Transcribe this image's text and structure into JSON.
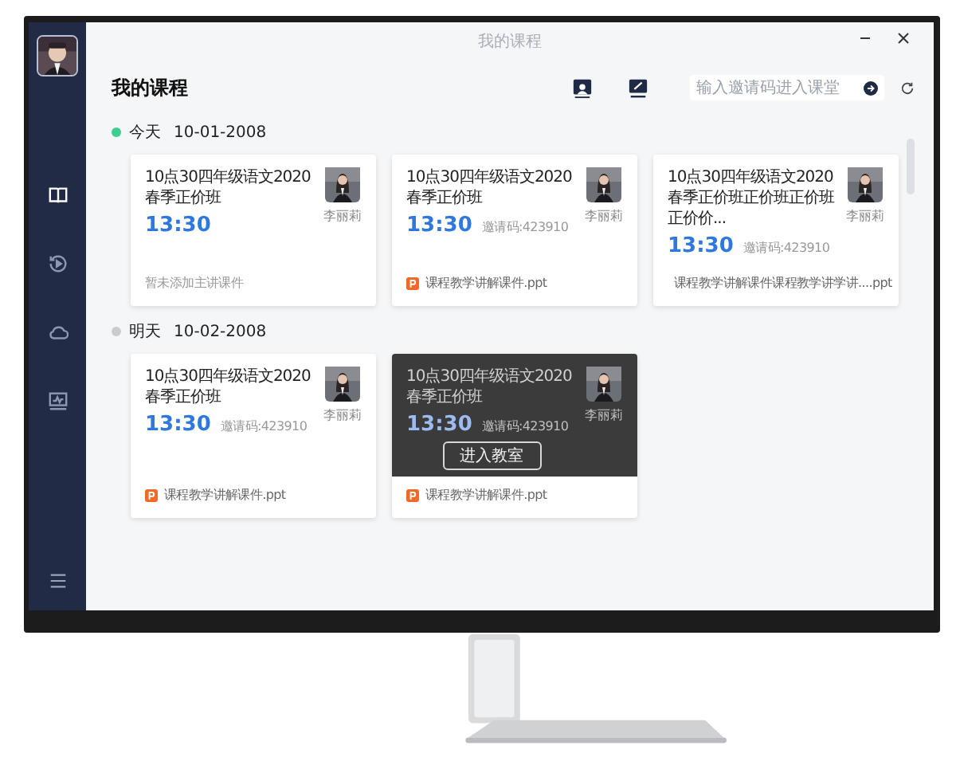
{
  "window": {
    "title": "我的课程"
  },
  "sidebar": {
    "items": [
      {
        "selected": true
      },
      {
        "selected": false
      },
      {
        "selected": false
      },
      {
        "selected": false
      }
    ]
  },
  "header": {
    "title": "我的课程",
    "invite": {
      "placeholder": "输入邀请码进入课堂"
    }
  },
  "sections": [
    {
      "day": "今天",
      "date": "10-01-2008",
      "active": true,
      "courses": [
        {
          "title": "10点30四年级语文2020春季正价班",
          "time": "13:30",
          "teacher": "李丽莉",
          "hovered": false,
          "file": {
            "kind": "note",
            "text": "暂未添加主讲课件"
          }
        },
        {
          "title": "10点30四年级语文2020春季正价班",
          "time": "13:30",
          "code": "邀请码:423910",
          "teacher": "李丽莉",
          "hovered": false,
          "file": {
            "kind": "ppt",
            "text": "课程教学讲解课件.ppt"
          }
        },
        {
          "title": "10点30四年级语文2020春季正价班正价班正价班正价价...",
          "time": "13:30",
          "code": "邀请码:423910",
          "teacher": "李丽莉",
          "hovered": false,
          "file": {
            "kind": "ppt",
            "text": "课程教学讲解课件课程教学讲学讲....ppt"
          }
        }
      ]
    },
    {
      "day": "明天",
      "date": "10-02-2008",
      "active": false,
      "courses": [
        {
          "title": "10点30四年级语文2020春季正价班",
          "time": "13:30",
          "code": "邀请码:423910",
          "teacher": "李丽莉",
          "hovered": false,
          "file": {
            "kind": "ppt",
            "text": "课程教学讲解课件.ppt"
          }
        },
        {
          "title": "10点30四年级语文2020春季正价班",
          "time": "13:30",
          "code": "邀请码:423910",
          "teacher": "李丽莉",
          "hovered": true,
          "enter_button": "进入教室",
          "file": {
            "kind": "ppt",
            "text": "课程教学讲解课件.ppt"
          }
        }
      ]
    }
  ]
}
